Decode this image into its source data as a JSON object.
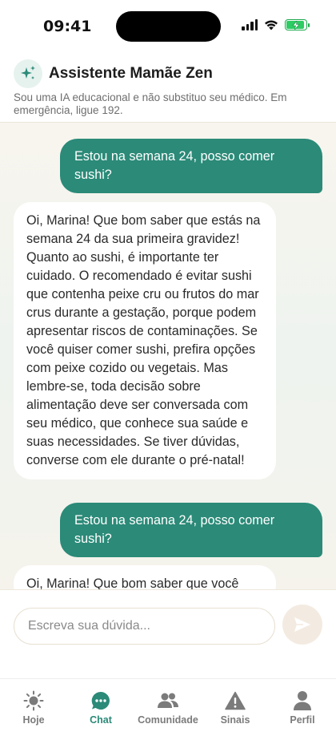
{
  "status_bar": {
    "time": "09:41"
  },
  "header": {
    "avatar_icon": "sparkles-icon",
    "title": "Assistente Mamãe Zen",
    "disclaimer": "Sou uma IA educacional e não substituo seu médico. Em emergência, ligue 192."
  },
  "messages": [
    {
      "role": "user",
      "text": "Estou na semana 24, posso comer sushi?"
    },
    {
      "role": "assistant",
      "text": "Oi, Marina! Que bom saber que estás na semana 24 da sua primeira gravidez! Quanto ao sushi, é importante ter cuidado. O recomendado é evitar sushi que contenha peixe cru ou frutos do mar crus durante a gestação, porque podem apresentar riscos de contaminações. Se você quiser comer sushi, prefira opções com peixe cozido ou vegetais. Mas lembre-se, toda decisão sobre alimentação deve ser conversada com seu médico, que conhece sua saúde e suas necessidades. Se tiver dúvidas, converse com ele durante o pré-natal!"
    },
    {
      "role": "user",
      "text": "Estou na semana 24, posso comer sushi?"
    },
    {
      "role": "assistant",
      "text": "Oi, Marina! Que bom saber que você"
    }
  ],
  "composer": {
    "placeholder": "Escreva sua dúvida...",
    "send_icon": "send-icon"
  },
  "nav": {
    "items": [
      {
        "label": "Hoje",
        "icon": "sun-icon",
        "active": false
      },
      {
        "label": "Chat",
        "icon": "chat-icon",
        "active": true
      },
      {
        "label": "Comunidade",
        "icon": "people-icon",
        "active": false
      },
      {
        "label": "Sinais",
        "icon": "warning-icon",
        "active": false
      },
      {
        "label": "Perfil",
        "icon": "person-icon",
        "active": false
      }
    ]
  },
  "colors": {
    "accent": "#2b8a78",
    "user_bubble": "#2b8a78",
    "assistant_bubble": "#ffffff",
    "send_button_bg": "#f3ebe1",
    "nav_inactive": "#7b7b7b"
  }
}
